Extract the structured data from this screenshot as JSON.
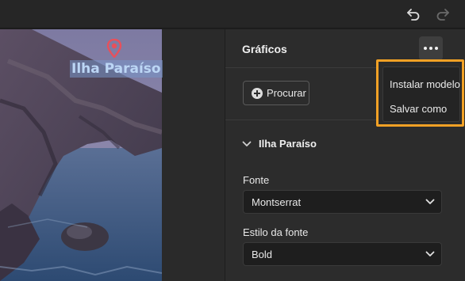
{
  "panel": {
    "title": "Gráficos",
    "browse_label": "Procurar",
    "section_title": "Ilha Paraíso",
    "font_label": "Fonte",
    "font_value": "Montserrat",
    "style_label": "Estilo da fonte",
    "style_value": "Bold"
  },
  "canvas": {
    "overlay_text": "Ilha Paraíso"
  },
  "menu": {
    "items": [
      "Instalar modelo",
      "Salvar como"
    ]
  },
  "colors": {
    "highlight": "#f2a125",
    "pin": "#e8505b"
  },
  "icons": {
    "undo": "undo-icon",
    "redo": "redo-icon",
    "more": "more-icon",
    "chevron": "chevron-down-icon",
    "pin": "map-pin-icon"
  }
}
